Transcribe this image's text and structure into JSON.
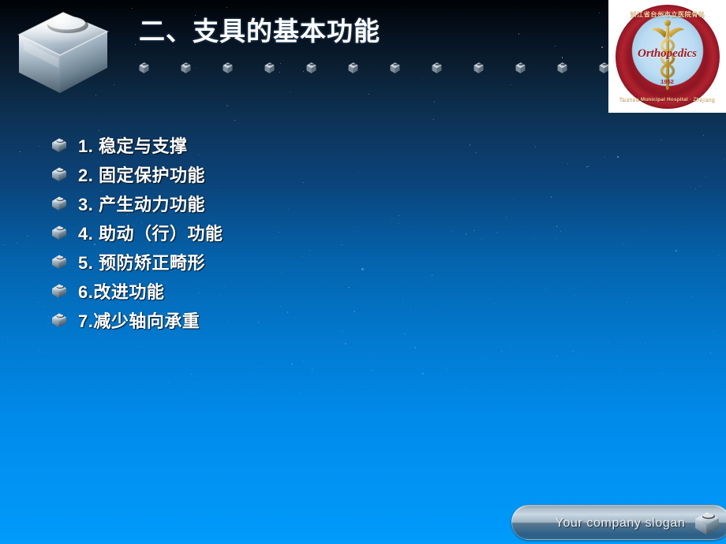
{
  "slide": {
    "title": "二、支具的基本功能",
    "background_top_color": "#000305",
    "background_bottom_color": "#009bfb"
  },
  "header": {
    "hero_icon": "chrome-cube-icon",
    "decor_icon": "mini-cube-icon",
    "decor_cube_count": 13
  },
  "logo": {
    "chinese_ring_text": "浙江省台州市立医院骨科",
    "center_word": "Orthopedics",
    "year": "1952",
    "english_ring_text": "Taizhou Municipal Hospital · Zhejiang",
    "plate_color": "#ffffff",
    "ring_color": "#9c1a24"
  },
  "bullets": [
    {
      "marker": "1.",
      "label": "1. 稳定与支撑"
    },
    {
      "marker": "2.",
      "label": "2. 固定保护功能"
    },
    {
      "marker": "3.",
      "label": "3. 产生动力功能"
    },
    {
      "marker": "4.",
      "label": "4. 助动（行）功能"
    },
    {
      "marker": "5.",
      "label": "5. 预防矫正畸形"
    },
    {
      "marker": "6.",
      "label": "6.改进功能"
    },
    {
      "marker": "7.",
      "label": "7.减少轴向承重"
    }
  ],
  "footer": {
    "slogan": "Your company slogan",
    "icon": "cube-icon"
  }
}
